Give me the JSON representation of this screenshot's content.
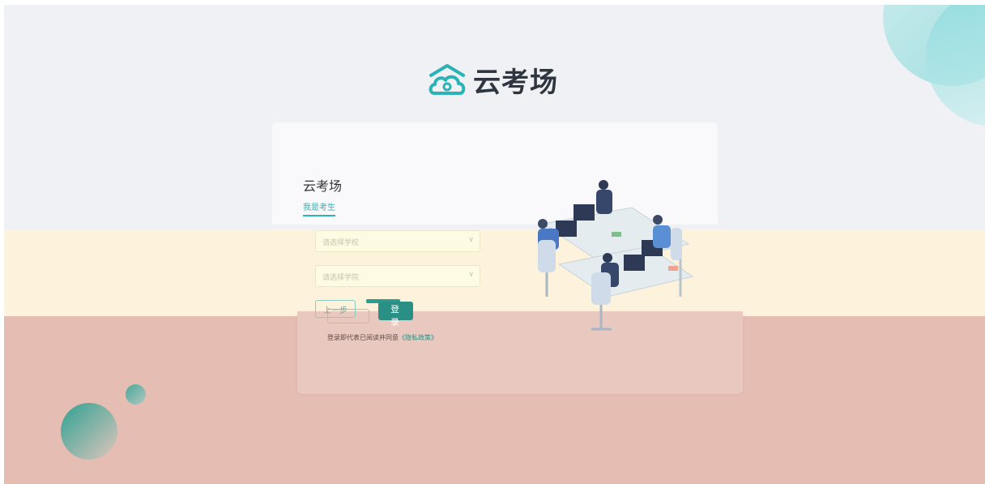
{
  "brand": {
    "name": "云考场",
    "color": "#2bb3b6"
  },
  "login_card": {
    "title": "云考场",
    "active_tab": "我是考生",
    "school_select": {
      "placeholder": "请选择学校"
    },
    "college_select": {
      "placeholder": "请选择学院"
    },
    "prev_button": "上一步",
    "login_button": "登 录",
    "agreement_text": "登录即代表已阅读并同意",
    "privacy_link": "《隐私政策》"
  },
  "illustration": {
    "icon": "office-workers-illustration"
  },
  "colors": {
    "accent": "#2bb3b6",
    "button": "#2a8f85",
    "background": "#f0f1f5"
  }
}
